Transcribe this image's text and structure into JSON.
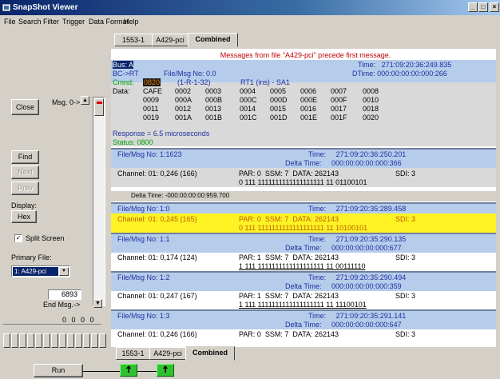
{
  "window": {
    "title": "SnapShot Viewer",
    "min_btn": "_",
    "max_btn": "□",
    "close_btn": "×"
  },
  "menu": [
    "File",
    "Search",
    "Filter",
    "Trigger",
    "Data Format",
    "Help"
  ],
  "tabs": [
    "1553-1",
    "A429-pci",
    "Combined"
  ],
  "left": {
    "close": "Close",
    "msg_label": "Msg. 0->",
    "find": "Find",
    "next": "Next",
    "prev": "Prev",
    "display_label": "Display:",
    "display_value": "Hex",
    "split_screen": "Split Screen",
    "primary_file_label": "Primary File:",
    "primary_file_value": "1: A429-pci",
    "count_value": "6893",
    "end_msg": "End Msg.->",
    "counters": "0  0  0  0",
    "run": "Run"
  },
  "main": {
    "header": "Messages from file \"A429-pci\" precede first message.",
    "b1": {
      "bus": "Bus: A",
      "time": "Time:   271:09:20:36:249.835",
      "bcrt": "BC->RT",
      "file": "File/Msg No: 0.0",
      "dtime": "DTime: 000:00:00:00:000:266",
      "cmnd": "Cmnd:",
      "cmnd_val": "0820",
      "cmnd_desc": "(1-R-1-32)",
      "rt": "RT1 (ins) - SA1",
      "data_label": "Data:",
      "data": [
        [
          "CAFE",
          "0002",
          "0003",
          "0004",
          "0005",
          "0006",
          "0007",
          "0008"
        ],
        [
          "0009",
          "000A",
          "000B",
          "000C",
          "000D",
          "000E",
          "000F",
          "0010"
        ],
        [
          "0011",
          "0012",
          "0013",
          "0014",
          "0015",
          "0016",
          "0017",
          "0018"
        ],
        [
          "0019",
          "001A",
          "001B",
          "001C",
          "001D",
          "001E",
          "001F",
          "0020"
        ]
      ],
      "response": "Response = 6.5 microseconds",
      "status": "Status: 0800"
    },
    "b2": {
      "file": "File/Msg No: 1:1623",
      "time": "Time:     271:09:20:36:250.201",
      "dtime": "Delta Time:     000:00:00:00:000:366",
      "channel": "Channel: 01: 0,246 (166)",
      "par": "PAR: 0  SSM: 7  DATA: 262143",
      "sdi": "SDI: 3",
      "bits": "0 111 1111111111111111111 11 01100101"
    },
    "delta": "Delta Time: -000:00:00:00:959.700",
    "entries": [
      {
        "file": "File/Msg No: 1:0",
        "time": "Time:     271:09:20:35:289.458",
        "dtime": "",
        "channel": "Channel: 01: 0,245 (165)",
        "par": "PAR: 0  SSM: 7  DATA: 262143",
        "sdi": "SDI: 3",
        "bits": "0 111 1111111111111111111 11 10100101"
      },
      {
        "file": "File/Msg No: 1:1",
        "time": "Time:     271:09:20:35:290.135",
        "dtime": "Delta Time:     000:00:00:00:000:677",
        "channel": "Channel: 01: 0,174 (124)",
        "par": "PAR: 1  SSM: 7  DATA: 262143",
        "sdi": "SDI: 3",
        "bits": "1 111 1111111111111111111 11 00111110"
      },
      {
        "file": "File/Msg No: 1:2",
        "time": "Time:     271:09:20:35:290.494",
        "dtime": "Delta Time:     000:00:00:00:000:359",
        "channel": "Channel: 01: 0,247 (167)",
        "par": "PAR: 1  SSM: 7  DATA: 262143",
        "sdi": "SDI: 3",
        "bits": "1 111 1111111111111111111 11 11100101"
      },
      {
        "file": "File/Msg No: 1:3",
        "time": "Time:     271:09:20:35:291.141",
        "dtime": "Delta Time:     000:00:00:00:000:647",
        "channel": "Channel: 01: 0,246 (166)",
        "par": "PAR: 0  SSM: 7  DATA: 262143",
        "sdi": "SDI: 3",
        "bits": ""
      }
    ]
  },
  "arrows": [
    "🠅",
    "🠅"
  ]
}
